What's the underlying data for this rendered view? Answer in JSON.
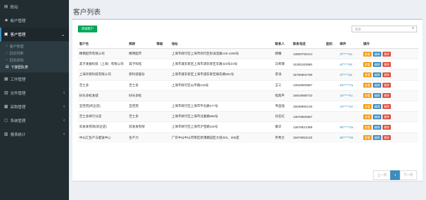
{
  "sidebar": {
    "items": [
      {
        "label": "航站",
        "icon": "dashboard-icon"
      },
      {
        "label": "帐户管理",
        "icon": "users-icon"
      },
      {
        "label": "客户管理",
        "icon": "folder-icon"
      },
      {
        "label": "工作管理",
        "icon": "briefcase-icon"
      },
      {
        "label": "交件管理",
        "icon": "file-icon"
      },
      {
        "label": "采购管理",
        "icon": "cart-icon"
      },
      {
        "label": "系统管理",
        "icon": "gear-icon"
      },
      {
        "label": "报表统计",
        "icon": "chart-icon"
      }
    ],
    "submenu": [
      "客户管理",
      "回访列表",
      "回访添加",
      "下游团队表"
    ]
  },
  "page": {
    "title": "客户列表"
  },
  "toolbar": {
    "add_label": "添加客户",
    "search_placeholder": "搜索"
  },
  "table": {
    "headers": [
      "客户名",
      "简称",
      "等级",
      "地址",
      "联系人",
      "联系电话",
      "座机",
      "邮件",
      "操作"
    ],
    "rows": [
      [
        "精明超市有限公司",
        "精明超市",
        "",
        "上海市闵行区上海市闵行区秋溪莲路126-1208号",
        "杨曦",
        "13800782214",
        "",
        "2f*****2a"
      ],
      [
        "其子发展科技（上海）有限公司",
        "其子科技",
        "",
        "上海市浦东新区上海市浦东新区东路423号23号",
        "冯英璞",
        "15381183988",
        "",
        "af*****46"
      ],
      [
        "上海华新科技有限公司",
        "新科技股份",
        "",
        "上海市浦东新区上海市浦东新区联东路551号",
        "李涛",
        "18756802789",
        "",
        "4f*****a5"
      ],
      [
        "吉士多",
        "吉士多",
        "",
        "上海市闵行区山平路218号",
        "王三",
        "13628900587",
        "",
        "83*****7a"
      ],
      [
        "好乐多批发城",
        "好乐多批",
        "",
        "",
        "程再平",
        "18918689733",
        "",
        "15*****6c"
      ],
      [
        "宜佳苑(闵企店)",
        "宜佳苑",
        "",
        "上海市闵行区上海市平北路477号",
        "韦品强",
        "15638892146",
        "",
        "c8*****a2"
      ],
      [
        "吉士多闵行分店",
        "吉士多",
        "",
        "上海市闵行区上海市北翟路888号",
        "孙志红",
        "13678900587",
        "",
        ""
      ],
      [
        "双发发有限(闵企店)",
        "双发发有限",
        "",
        "上海市闵行区上海市沪宝路115号",
        "秦华",
        "13678521389",
        "",
        "8b*****3a"
      ],
      [
        "中山汇生产与配送中心",
        "生产力",
        "",
        "广东中山中山市南区新港路园区大道303，305室",
        "罗秀兰",
        "15678953125",
        "",
        "80*****35"
      ]
    ],
    "actions": [
      "查看",
      "编辑",
      "删除"
    ]
  },
  "pagination": {
    "prev": "上一页",
    "current": "1",
    "next": "下一页"
  },
  "colors": {
    "sidebar": "#222d32",
    "accent": "#3c8dbc",
    "add": "#00a65a",
    "view": "#f39c12",
    "delete": "#dd4b39"
  }
}
